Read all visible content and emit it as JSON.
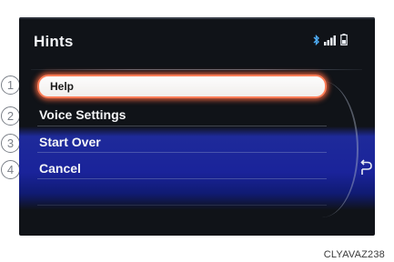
{
  "screen": {
    "title": "Hints",
    "status_icons": [
      "bluetooth-icon",
      "signal-strength-icon",
      "battery-icon"
    ]
  },
  "menu": {
    "items": [
      {
        "number": "1",
        "label": "Help",
        "selected": true
      },
      {
        "number": "2",
        "label": "Voice Settings",
        "selected": false
      },
      {
        "number": "3",
        "label": "Start Over",
        "selected": false
      },
      {
        "number": "4",
        "label": "Cancel",
        "selected": false
      }
    ]
  },
  "controls": {
    "back_icon": "back-arrow-icon"
  },
  "caption": "CLYAVAZ238",
  "colors": {
    "screen_bg": "#101318",
    "highlight_border": "#ff7d57",
    "band_blue": "#1a239a",
    "text": "#f4f5f7"
  }
}
